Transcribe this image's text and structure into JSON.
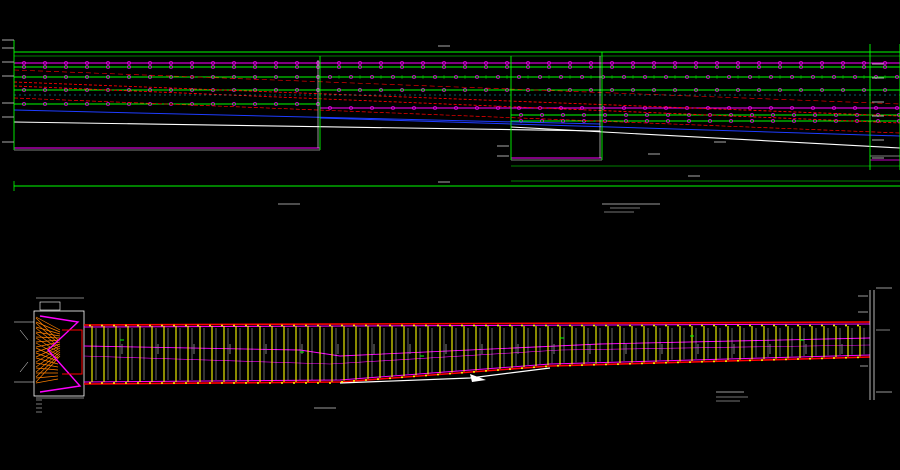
{
  "drawing": {
    "background": "#000000",
    "colors": {
      "green": "#00ff00",
      "magenta": "#ff00ff",
      "red": "#ff0000",
      "blue": "#1e3cff",
      "white": "#ffffff",
      "yellow": "#ffff00",
      "cyan": "#00ffff",
      "orange": "#ff8000",
      "gray": "#9a9a9a"
    }
  },
  "labels": {
    "elevation_view_title": "",
    "elevation_view_note": "",
    "section_title": "",
    "section_note": ""
  }
}
